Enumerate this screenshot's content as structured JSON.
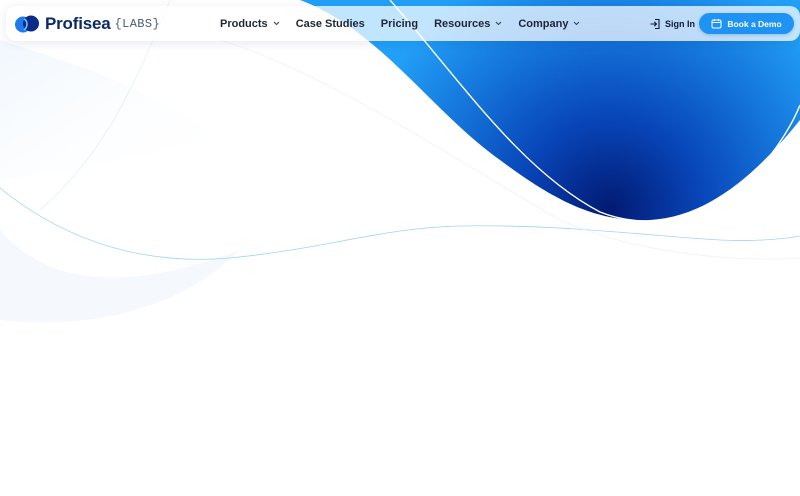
{
  "brand": {
    "name": "Profisea",
    "sub": "{LABS}",
    "logo_icon": "profisea-logo-icon"
  },
  "nav": {
    "items": [
      {
        "label": "Products",
        "dropdown": true
      },
      {
        "label": "Case Studies",
        "dropdown": false
      },
      {
        "label": "Pricing",
        "dropdown": false
      },
      {
        "label": "Resources",
        "dropdown": true
      },
      {
        "label": "Company",
        "dropdown": true
      }
    ],
    "signin_label": "Sign In",
    "signin_icon": "login-icon",
    "demo_label": "Book a Demo",
    "demo_icon": "calendar-icon"
  },
  "colors": {
    "primary_blue": "#1f93f3",
    "deep_blue": "#031f7a",
    "brand_text": "#0d2a66"
  }
}
